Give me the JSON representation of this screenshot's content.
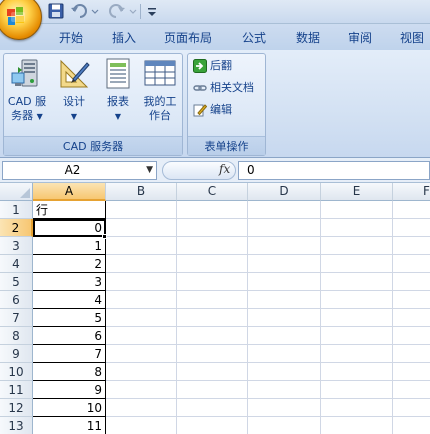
{
  "quick_access": {
    "save_icon": "save-icon",
    "undo_icon": "undo-icon",
    "redo_icon": "redo-icon",
    "customize_icon": "customize-toolbar-icon"
  },
  "tabs": [
    {
      "label": "开始"
    },
    {
      "label": "插入"
    },
    {
      "label": "页面布局"
    },
    {
      "label": "公式"
    },
    {
      "label": "数据"
    },
    {
      "label": "审阅"
    },
    {
      "label": "视图"
    }
  ],
  "ribbon": {
    "cad_group": {
      "title": "CAD 服务器",
      "buttons": [
        {
          "line1": "CAD 服",
          "line2": "务器",
          "icon": "cad-server-icon",
          "has_dropdown": true
        },
        {
          "line1": "设计",
          "line2": "",
          "icon": "design-icon",
          "has_dropdown": true
        },
        {
          "line1": "报表",
          "line2": "",
          "icon": "report-icon",
          "has_dropdown": true
        },
        {
          "line1": "我的工",
          "line2": "作台",
          "icon": "workbench-icon",
          "has_dropdown": false
        }
      ]
    },
    "form_group": {
      "title": "表单操作",
      "buttons": [
        {
          "label": "后翻",
          "icon": "next-page-icon"
        },
        {
          "label": "相关文档",
          "icon": "link-icon"
        },
        {
          "label": "编辑",
          "icon": "edit-icon"
        }
      ]
    }
  },
  "formula_bar": {
    "name_box": "A2",
    "fx": "fx",
    "value": "0"
  },
  "sheet": {
    "columns": [
      "A",
      "B",
      "C",
      "D",
      "E",
      "F"
    ],
    "selected_column": "A",
    "selected_cell": "A2",
    "rows": [
      {
        "row": "1",
        "a": "行"
      },
      {
        "row": "2",
        "a": "0"
      },
      {
        "row": "3",
        "a": "1"
      },
      {
        "row": "4",
        "a": "2"
      },
      {
        "row": "5",
        "a": "3"
      },
      {
        "row": "6",
        "a": "4"
      },
      {
        "row": "7",
        "a": "5"
      },
      {
        "row": "8",
        "a": "6"
      },
      {
        "row": "9",
        "a": "7"
      },
      {
        "row": "10",
        "a": "8"
      },
      {
        "row": "11",
        "a": "9"
      },
      {
        "row": "12",
        "a": "10"
      },
      {
        "row": "13",
        "a": "11"
      }
    ]
  }
}
